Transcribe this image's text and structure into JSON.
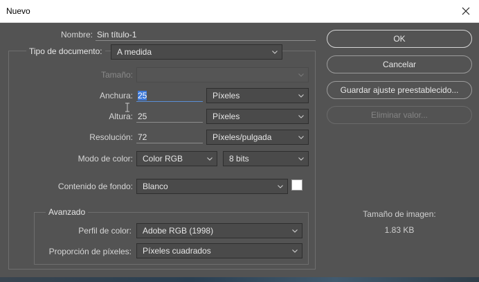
{
  "window": {
    "title": "Nuevo"
  },
  "form": {
    "name_label": "Nombre:",
    "name_value": "Sin título-1",
    "doc_type_label": "Tipo de documento:",
    "doc_type_value": "A medida",
    "size_label": "Tamaño:",
    "size_value": "",
    "width_label": "Anchura:",
    "width_value": "25",
    "width_unit": "Píxeles",
    "height_label": "Altura:",
    "height_value": "25",
    "height_unit": "Píxeles",
    "resolution_label": "Resolución:",
    "resolution_value": "72",
    "resolution_unit": "Píxeles/pulgada",
    "color_mode_label": "Modo de color:",
    "color_mode_value": "Color RGB",
    "bit_depth_value": "8 bits",
    "background_label": "Contenido de fondo:",
    "background_value": "Blanco",
    "background_swatch_color": "#ffffff"
  },
  "advanced": {
    "legend": "Avanzado",
    "profile_label": "Perfil de color:",
    "profile_value": "Adobe RGB (1998)",
    "aspect_label": "Proporción de píxeles:",
    "aspect_value": "Píxeles cuadrados"
  },
  "buttons": {
    "ok": "OK",
    "cancel": "Cancelar",
    "save_preset": "Guardar ajuste preestablecido...",
    "delete_preset": "Eliminar valor..."
  },
  "image_info": {
    "label": "Tamaño de imagen:",
    "value": "1.83 KB"
  },
  "colors": {
    "panel_bg": "#535353",
    "selection": "#3c78d8"
  }
}
